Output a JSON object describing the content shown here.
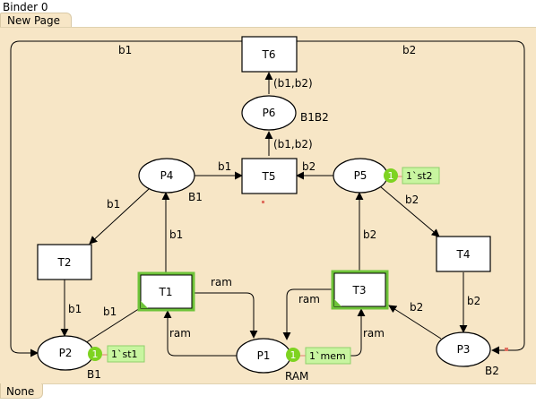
{
  "binder": {
    "title": "Binder 0"
  },
  "tab": {
    "label": "New Page"
  },
  "status": {
    "text": "None"
  },
  "net": {
    "places": [
      {
        "id": "P1",
        "label": "P1",
        "colorset": "RAM",
        "tokens": "1",
        "marking": "1`mem"
      },
      {
        "id": "P2",
        "label": "P2",
        "colorset": "B1",
        "tokens": "1",
        "marking": "1`st1"
      },
      {
        "id": "P3",
        "label": "P3",
        "colorset": "B2",
        "tokens": "",
        "marking": ""
      },
      {
        "id": "P4",
        "label": "P4",
        "colorset": "B1",
        "tokens": "",
        "marking": ""
      },
      {
        "id": "P5",
        "label": "P5",
        "colorset": "",
        "tokens": "1",
        "marking": "1`st2"
      },
      {
        "id": "P6",
        "label": "P6",
        "colorset": "B1B2",
        "tokens": "",
        "marking": ""
      }
    ],
    "transitions": [
      {
        "id": "T1",
        "label": "T1",
        "enabled": true
      },
      {
        "id": "T2",
        "label": "T2",
        "enabled": false
      },
      {
        "id": "T3",
        "label": "T3",
        "enabled": true
      },
      {
        "id": "T4",
        "label": "T4",
        "enabled": false
      },
      {
        "id": "T5",
        "label": "T5",
        "enabled": false
      },
      {
        "id": "T6",
        "label": "T6",
        "enabled": false
      }
    ],
    "arcs": [
      {
        "id": "b1-top",
        "inscription": "b1"
      },
      {
        "id": "b2-top",
        "inscription": "b2"
      },
      {
        "id": "t6-p6",
        "inscription": "(b1,b2)"
      },
      {
        "id": "p6-t5",
        "inscription": "(b1,b2)"
      },
      {
        "id": "p4-t5",
        "inscription": "b1"
      },
      {
        "id": "p5-t5",
        "inscription": "b2"
      },
      {
        "id": "p4-t2",
        "inscription": "b1"
      },
      {
        "id": "t1-p4",
        "inscription": "b1"
      },
      {
        "id": "p5-t4",
        "inscription": "b2"
      },
      {
        "id": "t3-p5",
        "inscription": "b2"
      },
      {
        "id": "t2-p2",
        "inscription": "b1"
      },
      {
        "id": "p2-t1",
        "inscription": "b1"
      },
      {
        "id": "t1-p1",
        "inscription": "ram"
      },
      {
        "id": "p1-t1",
        "inscription": "ram"
      },
      {
        "id": "t3-p1",
        "inscription": "ram"
      },
      {
        "id": "p1-t3",
        "inscription": "ram"
      },
      {
        "id": "t4-p3",
        "inscription": "b2"
      },
      {
        "id": "p3-t3",
        "inscription": "b2"
      }
    ]
  },
  "colors": {
    "canvas": "#f7e6c6",
    "enabled_border": "#6fc43a",
    "token_fill": "#7ed321",
    "marking_fill": "#c8f5a0"
  }
}
